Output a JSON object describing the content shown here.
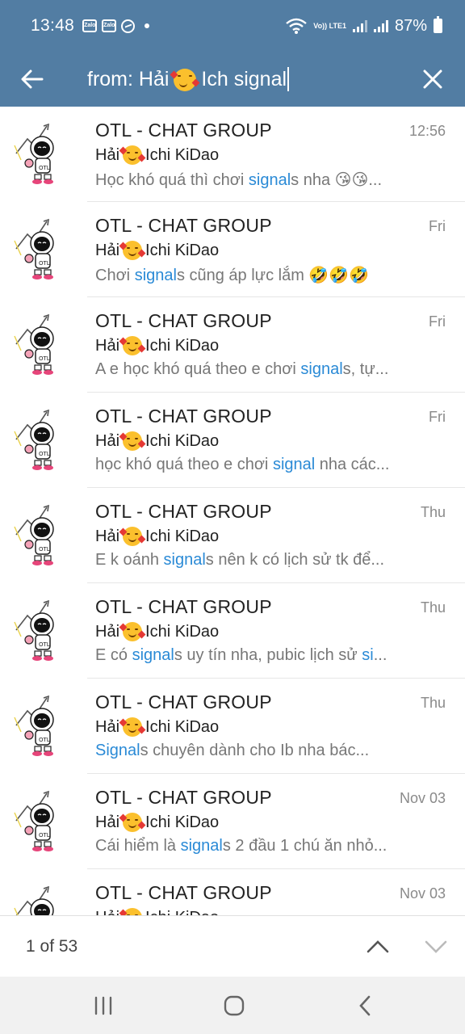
{
  "status_bar": {
    "time": "13:48",
    "notif_icons": [
      "zalo-icon",
      "zalo-icon",
      "messenger-icon"
    ],
    "volte_label": "Vo)) LTE1",
    "battery": "87%"
  },
  "search": {
    "query_prefix": "from: Hải",
    "query_suffix": "Ich signal"
  },
  "results": [
    {
      "title": "OTL - CHAT GROUP",
      "time": "12:56",
      "sender": "Hải",
      "sender_suffix": "Ichi KiDao",
      "msg_before": "Học khó quá thì chơi ",
      "msg_hl": "signal",
      "msg_after": "s nha 😘😘..."
    },
    {
      "title": "OTL - CHAT GROUP",
      "time": "Fri",
      "sender": "Hải",
      "sender_suffix": "Ichi KiDao",
      "msg_before": "Chơi ",
      "msg_hl": "signal",
      "msg_after": "s cũng áp lực lắm 🤣🤣🤣"
    },
    {
      "title": "OTL - CHAT GROUP",
      "time": "Fri",
      "sender": "Hải",
      "sender_suffix": "Ichi KiDao",
      "msg_before": "A e học khó quá theo e chơi ",
      "msg_hl": "signal",
      "msg_after": "s, tự..."
    },
    {
      "title": "OTL - CHAT GROUP",
      "time": "Fri",
      "sender": "Hải",
      "sender_suffix": "Ichi KiDao",
      "msg_before": "học khó quá theo e chơi ",
      "msg_hl": "signal",
      "msg_after": " nha các..."
    },
    {
      "title": "OTL - CHAT GROUP",
      "time": "Thu",
      "sender": "Hải",
      "sender_suffix": "Ichi KiDao",
      "msg_before": "E k oánh ",
      "msg_hl": "signal",
      "msg_after": "s nên k có lịch sử tk để..."
    },
    {
      "title": "OTL - CHAT GROUP",
      "time": "Thu",
      "sender": "Hải",
      "sender_suffix": "Ichi KiDao",
      "msg_before": "E có ",
      "msg_hl": "signal",
      "msg_after": "s uy tín nha, pubic lịch sử ",
      "msg_hl2": "si",
      "msg_after2": "..."
    },
    {
      "title": "OTL - CHAT GROUP",
      "time": "Thu",
      "sender": "Hải",
      "sender_suffix": "Ichi KiDao",
      "msg_before": "",
      "msg_hl": "Signal",
      "msg_after": "s chuyên dành cho Ib nha bác..."
    },
    {
      "title": "OTL - CHAT GROUP",
      "time": "Nov 03",
      "sender": "Hải",
      "sender_suffix": "Ichi KiDao",
      "msg_before": "Cái hiểm là ",
      "msg_hl": "signal",
      "msg_after": "s 2 đầu 1 chú ăn nhỏ..."
    },
    {
      "title": "OTL - CHAT GROUP",
      "time": "Nov 03",
      "sender": "Hải",
      "sender_suffix": "Ichi KiDao",
      "msg_before": "",
      "msg_hl": "",
      "msg_after": ""
    }
  ],
  "footer": {
    "counter": "1 of 53"
  },
  "colors": {
    "header_bg": "#527da3",
    "highlight": "#2a8ad6"
  }
}
